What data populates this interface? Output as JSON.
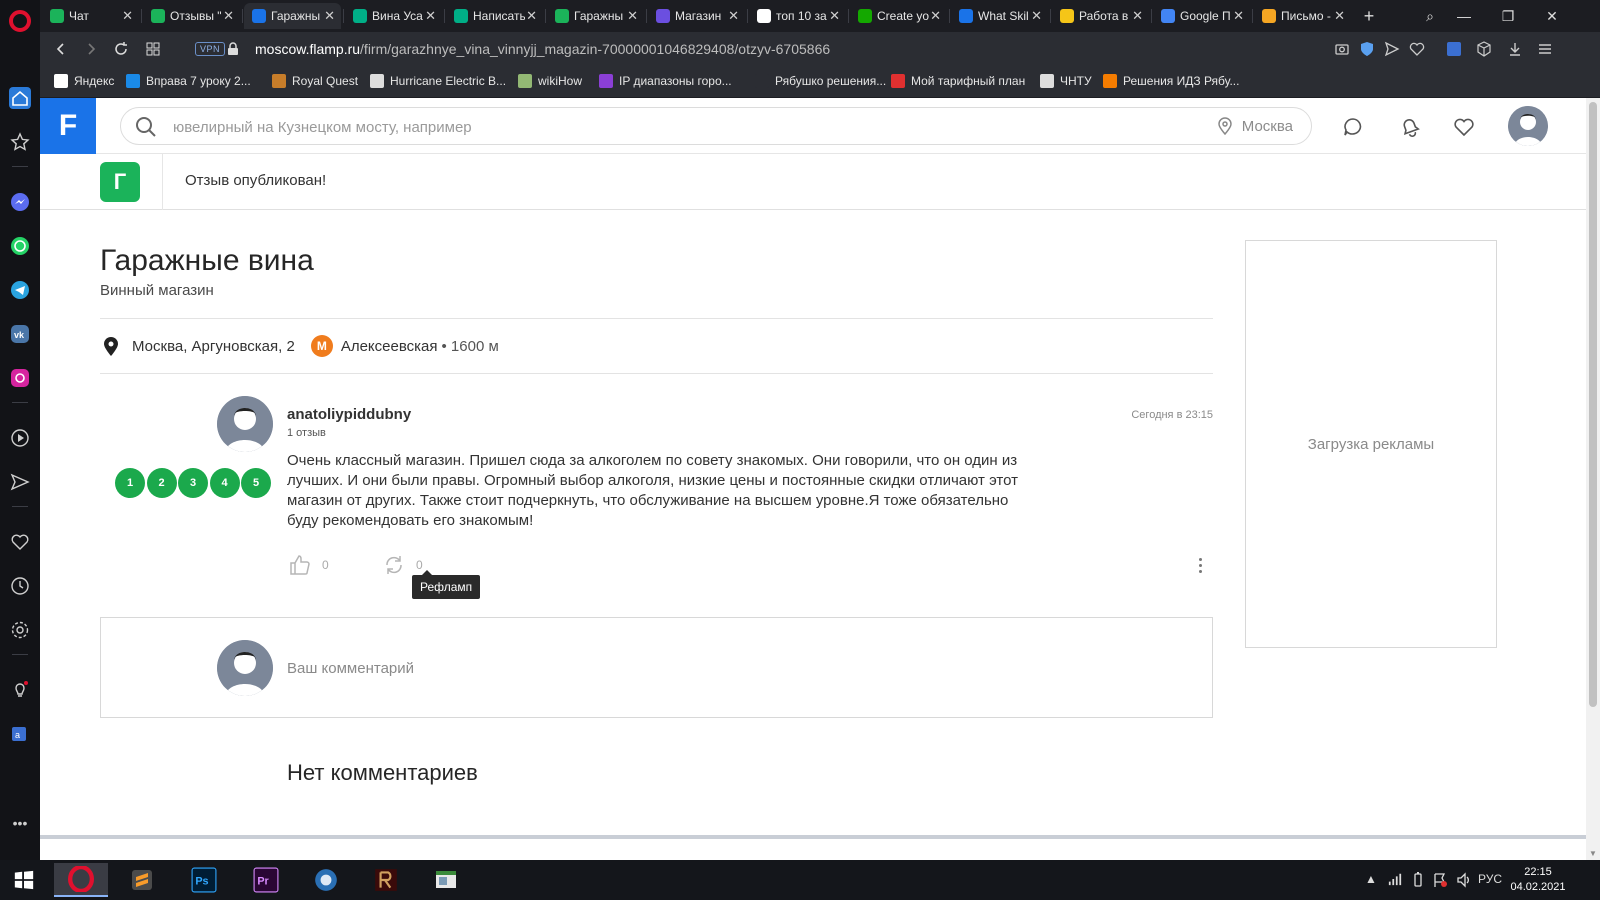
{
  "browser": {
    "tabs": [
      {
        "title": "Чат",
        "color": "#1bb35a"
      },
      {
        "title": "Отзывы \"",
        "color": "#1bb35a"
      },
      {
        "title": "Гаражны",
        "color": "#1a73e8",
        "active": true
      },
      {
        "title": "Вина Уса",
        "color": "#00af87"
      },
      {
        "title": "Написать",
        "color": "#00af87"
      },
      {
        "title": "Гаражны",
        "color": "#1bb35a"
      },
      {
        "title": "Магазин",
        "color": "#6b4fe0"
      },
      {
        "title": "топ 10 за",
        "color": "#ffffff"
      },
      {
        "title": "Create yo",
        "color": "#14a800"
      },
      {
        "title": "What Skil",
        "color": "#1a73e8"
      },
      {
        "title": "Работа в",
        "color": "#f5c518"
      },
      {
        "title": "Google П",
        "color": "#4285f4"
      },
      {
        "title": "Письмо -",
        "color": "#f5a623"
      }
    ],
    "vpn_label": "VPN",
    "url_host": "moscow.flamp.ru",
    "url_prefix": "",
    "url_path": "/firm/garazhnye_vina_vinnyjj_magazin-70000001046829408/otzyv-6705866",
    "bookmarks": [
      {
        "label": "Яндекс",
        "color": "#ffffff"
      },
      {
        "label": "Вправа 7 уроку 2...",
        "color": "#1a8ae8"
      },
      {
        "label": "Royal Quest",
        "color": "#c77d2a"
      },
      {
        "label": "Hurricane Electric B...",
        "color": "#dddddd"
      },
      {
        "label": "wikiHow",
        "color": "#93b874"
      },
      {
        "label": "IP диапазоны горо...",
        "color": "#8b3fd6"
      },
      {
        "label": "Рябушко решения...",
        "color": "#2b2d33"
      },
      {
        "label": "Мой тарифный план",
        "color": "#e03030"
      },
      {
        "label": "ЧНТУ",
        "color": "#dddddd"
      },
      {
        "label": "Решения ИДЗ Рябу...",
        "color": "#f57c00"
      }
    ]
  },
  "header": {
    "logo": "F",
    "search_placeholder": "ювелирный на Кузнецком мосту, например",
    "city": "Москва"
  },
  "notice": {
    "badge": "Г",
    "text": "Отзыв опубликован!"
  },
  "firm": {
    "name": "Гаражные вина",
    "category": "Винный магазин",
    "address": "Москва, Аргуновская, 2",
    "metro_icon": "М",
    "metro_station": "Алексеевская",
    "metro_distance": "• 1600 м"
  },
  "review": {
    "author": "anatoliypiddubny",
    "review_count": "1 отзыв",
    "date": "Сегодня в 23:15",
    "rating": [
      "1",
      "2",
      "3",
      "4",
      "5"
    ],
    "text": "Очень классный магазин. Пришел сюда за алкоголем по совету знакомых. Они говорили, что он один из лучших. И они были правы. Огромный выбор алкоголя, низкие цены и постоянные скидки отличают этот магазин от других. Также стоит подчеркнуть, что обслуживание на высшем уровне.Я тоже обязательно буду рекомендовать его знакомым!",
    "likes": "0",
    "reflamps": "0",
    "tooltip": "Рефламп"
  },
  "comments": {
    "placeholder": "Ваш комментарий",
    "empty_title": "Нет комментариев"
  },
  "ad": {
    "loading": "Загрузка рекламы"
  },
  "taskbar": {
    "lang": "РУС",
    "time": "22:15",
    "date": "04.02.2021"
  },
  "colors": {
    "brand_blue": "#1a73e8",
    "rating_green": "#1ba94c",
    "metro_orange": "#f07c1d"
  }
}
